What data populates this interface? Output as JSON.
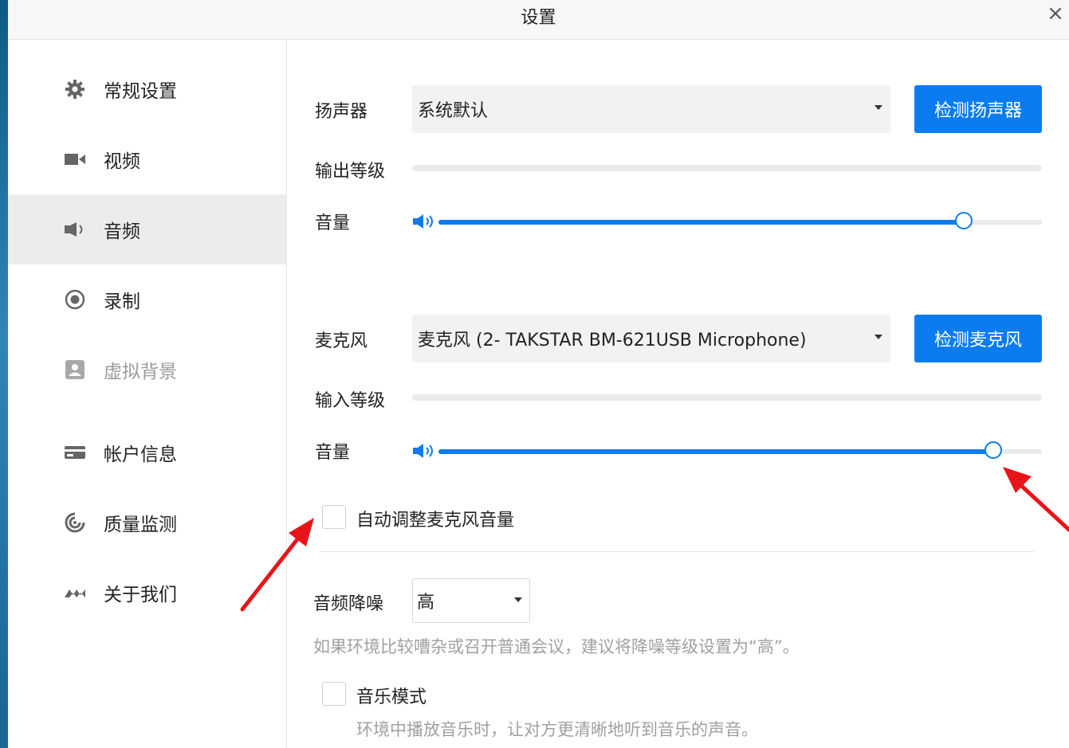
{
  "window": {
    "title": "设置",
    "close": "×"
  },
  "sidebar": {
    "items": [
      {
        "label": "常规设置",
        "icon": "gear-icon"
      },
      {
        "label": "视频",
        "icon": "video-camera-icon"
      },
      {
        "label": "音频",
        "icon": "speaker-icon",
        "active": true
      },
      {
        "label": "录制",
        "icon": "record-icon"
      },
      {
        "label": "虚拟背景",
        "icon": "portrait-icon",
        "disabled": true
      },
      {
        "label": "帐户信息",
        "icon": "card-icon"
      },
      {
        "label": "质量监测",
        "icon": "monitor-gauge-icon"
      },
      {
        "label": "关于我们",
        "icon": "logo-icon"
      }
    ]
  },
  "speaker": {
    "label": "扬声器",
    "device": "系统默认",
    "test_button": "检测扬声器",
    "output_level_label": "输出等级",
    "volume_label": "音量",
    "volume_fraction": 0.87
  },
  "microphone": {
    "label": "麦克风",
    "device": "麦克风 (2- TAKSTAR BM-621USB Microphone)",
    "test_button": "检测麦克风",
    "input_level_label": "输入等级",
    "volume_label": "音量",
    "volume_fraction": 0.92,
    "auto_adjust_label": "自动调整麦克风音量",
    "auto_adjust_checked": false
  },
  "noise_reduction": {
    "label": "音频降噪",
    "value": "高",
    "hint": "如果环境比较嘈杂或召开普通会议，建议将降噪等级设置为“高”。"
  },
  "music_mode": {
    "label": "音乐模式",
    "checked": false,
    "hint": "环境中播放音乐时，让对方更清晰地听到音乐的声音。"
  },
  "colors": {
    "accent": "#0a7cf0",
    "annotation": "#e8141a"
  }
}
